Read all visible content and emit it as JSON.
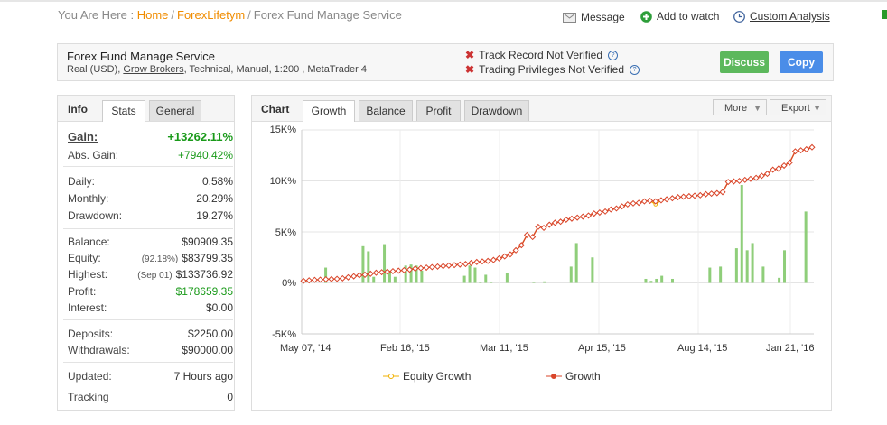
{
  "breadcrumb": {
    "prefix": "You Are Here :",
    "home": "Home",
    "sep": "/",
    "user": "ForexLifetym",
    "current": "Forex Fund Manage Service"
  },
  "top_actions": {
    "message": "Message",
    "add_to_watch": "Add to watch",
    "custom_analysis": "Custom Analysis"
  },
  "system": {
    "title": "Forex Fund Manage Service",
    "details_prefix": "Real (USD),",
    "broker": "Grow Brokers",
    "details_suffix": ", Technical, Manual, 1:200 , MetaTrader 4",
    "track_record": "Track Record Not Verified",
    "trading_privileges": "Trading Privileges Not Verified",
    "discuss": "Discuss",
    "copy": "Copy"
  },
  "colors": {
    "discuss": "#5cb85c",
    "copy": "#4a8de8",
    "growth": "#d9452a",
    "equity": "#f0b000",
    "bars": "#8fce7a",
    "accent": "#f08c00"
  },
  "info": {
    "tab_label": "Info",
    "tabs": [
      "Stats",
      "General"
    ],
    "gain_label": "Gain:",
    "gain_value": "+13262.11%",
    "abs_gain_label": "Abs. Gain:",
    "abs_gain_value": "+7940.42%",
    "daily_label": "Daily:",
    "daily_value": "0.58%",
    "monthly_label": "Monthly:",
    "monthly_value": "20.29%",
    "drawdown_label": "Drawdown:",
    "drawdown_value": "19.27%",
    "balance_label": "Balance:",
    "balance_value": "$90909.35",
    "equity_label": "Equity:",
    "equity_pct": "(92.18%)",
    "equity_value": "$83799.35",
    "highest_label": "Highest:",
    "highest_date": "(Sep 01)",
    "highest_value": "$133736.92",
    "profit_label": "Profit:",
    "profit_value": "$178659.35",
    "interest_label": "Interest:",
    "interest_value": "$0.00",
    "deposits_label": "Deposits:",
    "deposits_value": "$2250.00",
    "withdrawals_label": "Withdrawals:",
    "withdrawals_value": "$90000.00",
    "updated_label": "Updated:",
    "updated_value": "7 Hours ago",
    "tracking_label": "Tracking",
    "tracking_value": "0"
  },
  "chart_panel": {
    "tab_label": "Chart",
    "tabs": [
      "Growth",
      "Balance",
      "Profit",
      "Drawdown"
    ],
    "more": "More",
    "export": "Export"
  },
  "chart_data": {
    "type": "line",
    "y_ticks": [
      "15K%",
      "10K%",
      "5K%",
      "0%",
      "-5K%"
    ],
    "x_ticks": [
      "May 07, '14",
      "Feb 16, '15",
      "Mar 11, '15",
      "Apr 15, '15",
      "Aug 14, '15",
      "Jan 21, '16"
    ],
    "ylim": [
      -5000,
      15000
    ],
    "grid": true,
    "legend_placement": "bottom",
    "series": [
      {
        "name": "Equity Growth",
        "color": "#f0b000",
        "values": [
          200,
          250,
          300,
          320,
          350,
          380,
          400,
          450,
          550,
          650,
          750,
          800,
          900,
          1000,
          1050,
          1100,
          1150,
          1200,
          1250,
          1300,
          1400,
          1450,
          1500,
          1550,
          1600,
          1650,
          1700,
          1750,
          1800,
          1850,
          1950,
          2050,
          2100,
          2150,
          2250,
          2400,
          2600,
          2800,
          3200,
          3700,
          4700,
          4500,
          5500,
          5400,
          5700,
          5900,
          6000,
          6200,
          6300,
          6400,
          6500,
          6600,
          6800,
          6900,
          7000,
          7200,
          7300,
          7500,
          7700,
          7800,
          7850,
          8000,
          8050,
          7700,
          8100,
          8200,
          8300,
          8400,
          8450,
          8500,
          8550,
          8600,
          8700,
          8750,
          8800,
          8900,
          9900,
          9950,
          10000,
          10100,
          10200,
          10300,
          10500,
          10700,
          11100,
          11200,
          11500,
          11800,
          12900,
          13000,
          13100,
          13300
        ]
      },
      {
        "name": "Growth",
        "color": "#d9452a",
        "values": [
          200,
          250,
          300,
          320,
          350,
          380,
          400,
          450,
          550,
          650,
          750,
          800,
          900,
          1000,
          1050,
          1100,
          1150,
          1200,
          1250,
          1300,
          1400,
          1450,
          1500,
          1550,
          1600,
          1650,
          1700,
          1750,
          1800,
          1850,
          1950,
          2050,
          2100,
          2150,
          2250,
          2400,
          2600,
          2800,
          3200,
          3700,
          4700,
          4500,
          5500,
          5400,
          5700,
          5900,
          6000,
          6200,
          6300,
          6400,
          6500,
          6600,
          6800,
          6900,
          7000,
          7200,
          7300,
          7500,
          7700,
          7800,
          7850,
          8000,
          8050,
          8000,
          8100,
          8200,
          8300,
          8400,
          8450,
          8500,
          8550,
          8600,
          8700,
          8750,
          8800,
          8900,
          9900,
          9950,
          10000,
          10100,
          10200,
          10300,
          10500,
          10700,
          11100,
          11200,
          11500,
          11800,
          12900,
          13000,
          13100,
          13300
        ]
      }
    ],
    "bars": [
      0,
      0,
      0,
      0,
      1500,
      0,
      0,
      0,
      0,
      0,
      0,
      3600,
      3100,
      600,
      0,
      3800,
      1200,
      600,
      0,
      1700,
      1800,
      1700,
      1200,
      0,
      0,
      0,
      0,
      0,
      0,
      0,
      700,
      1700,
      1500,
      100,
      800,
      100,
      0,
      0,
      1000,
      0,
      0,
      0,
      0,
      100,
      0,
      150,
      0,
      0,
      0,
      0,
      1600,
      3900,
      0,
      0,
      2500,
      0,
      0,
      0,
      0,
      0,
      0,
      0,
      0,
      0,
      400,
      200,
      400,
      700,
      0,
      400,
      0,
      0,
      0,
      0,
      0,
      0,
      1500,
      0,
      1600,
      0,
      0,
      3400,
      9600,
      3200,
      3900,
      0,
      1600,
      0,
      0,
      500,
      3200,
      0,
      0,
      0,
      7000,
      0
    ]
  },
  "legend": {
    "equity": "Equity Growth",
    "growth": "Growth"
  }
}
